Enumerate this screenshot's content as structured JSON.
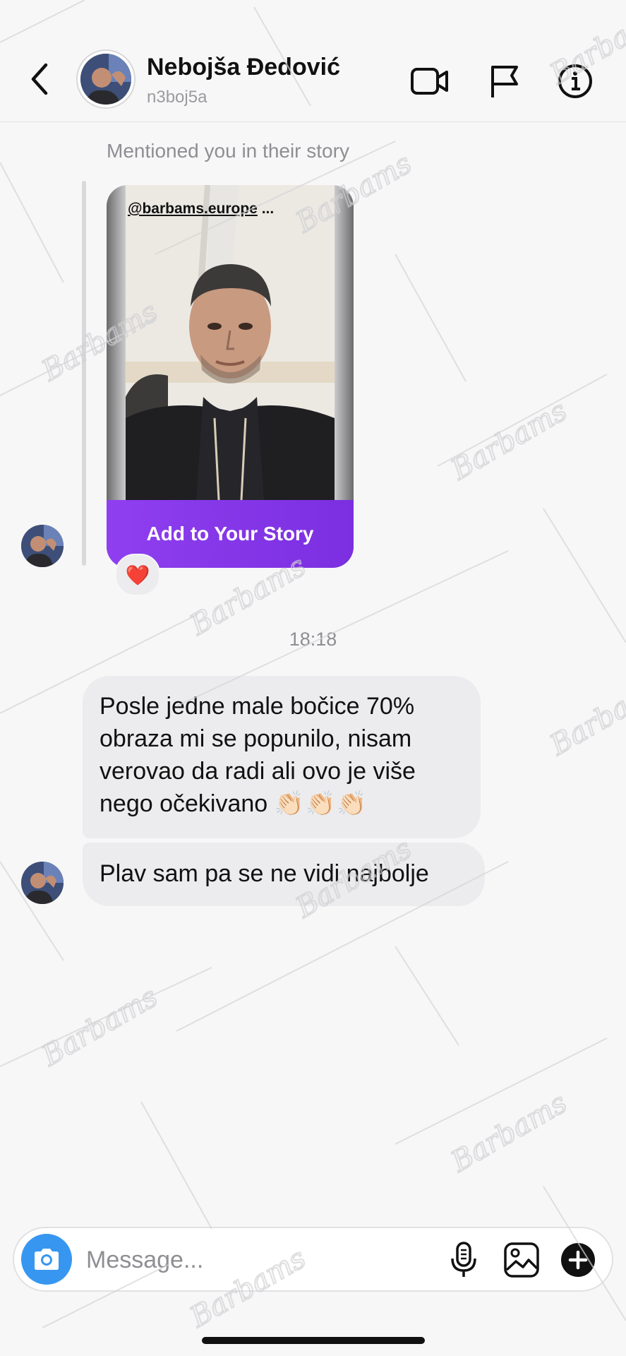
{
  "header": {
    "back_icon": "chevron-left-icon",
    "user_name": "Nebojša Đedović",
    "user_handle": "n3boj5a",
    "actions": [
      "video-call-icon",
      "flag-icon",
      "info-icon"
    ]
  },
  "story_mention": {
    "label": "Mentioned you in their story",
    "mention_handle": "@barbams.europe",
    "mention_suffix": " ...",
    "button_label": "Add to Your Story",
    "reaction": "❤️",
    "button_color": "#8f3ff0"
  },
  "timestamp": "18:18",
  "messages": [
    {
      "lines": [
        "Posle jedne male bočice 70%",
        "obraza mi se popunilo, nisam",
        "verovao da radi ali ovo je više",
        "nego očekivano"
      ],
      "emoji": "👏🏻👏🏻👏🏻"
    },
    {
      "text": "Plav sam pa se ne vidi najbolje"
    }
  ],
  "composer": {
    "placeholder": "Message...",
    "icons": [
      "camera-icon",
      "microphone-icon",
      "gallery-icon",
      "plus-icon"
    ],
    "camera_color": "#3797f0"
  },
  "watermark": "Barbams"
}
